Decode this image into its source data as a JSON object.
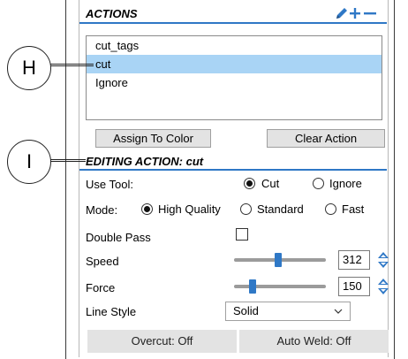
{
  "annotations": {
    "callout_h": "H",
    "callout_i": "I"
  },
  "actions": {
    "title": "ACTIONS",
    "items": [
      "cut_tags",
      "cut",
      "Ignore"
    ],
    "selected_index": 1,
    "assign_button": "Assign To Color",
    "clear_button": "Clear Action"
  },
  "editing": {
    "title": "EDITING ACTION: cut",
    "use_tool": {
      "label": "Use Tool:",
      "options": [
        "Cut",
        "Ignore"
      ],
      "selected": "Cut"
    },
    "mode": {
      "label": "Mode:",
      "options": [
        "High Quality",
        "Standard",
        "Fast"
      ],
      "selected": "High Quality"
    },
    "double_pass": {
      "label": "Double Pass",
      "checked": false
    },
    "speed": {
      "label": "Speed",
      "value": "312",
      "slider_fraction": 0.48
    },
    "force": {
      "label": "Force",
      "value": "150",
      "slider_fraction": 0.18
    },
    "line_style": {
      "label": "Line Style",
      "value": "Solid"
    },
    "overcut_button": "Overcut: Off",
    "autoweld_button": "Auto Weld: Off"
  },
  "colors": {
    "accent": "#2f78c6",
    "selection": "#a9d4f5"
  },
  "icons": {
    "edit": "pencil-icon",
    "add": "plus-icon",
    "remove": "minus-icon",
    "spin": "spin-arrows-icon",
    "dropdown": "chevron-down-icon"
  }
}
